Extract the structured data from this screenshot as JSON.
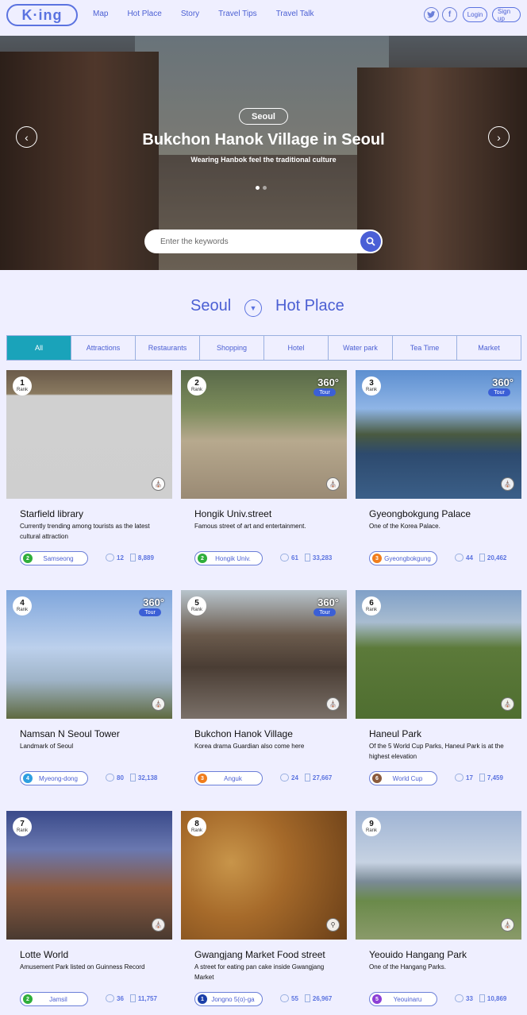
{
  "header": {
    "logo": "K·ing",
    "nav": [
      "Map",
      "Hot Place",
      "Story",
      "Travel Tips",
      "Travel Talk"
    ],
    "login": "Login",
    "signup": "Sign up"
  },
  "hero": {
    "tag": "Seoul",
    "title": "Bukchon Hanok Village in Seoul",
    "subtitle": "Wearing Hanbok feel the traditional culture",
    "search_placeholder": "Enter the keywords"
  },
  "section": {
    "city": "Seoul",
    "title": "Hot Place"
  },
  "tabs": [
    "All",
    "Attractions",
    "Restaurants",
    "Shopping",
    "Hotel",
    "Water park",
    "Tea Time",
    "Market"
  ],
  "rank_label": "Rank",
  "tour_label": "Tour",
  "tour_deg": "360°",
  "cards": [
    {
      "rank": "1",
      "name": "Starfield library",
      "desc": "Currently trending among tourists as the latest cultural attraction",
      "line": "2",
      "line_color": "#2fae3a",
      "station": "Samseong",
      "comments": "12",
      "bookmarks": "8,889"
    },
    {
      "rank": "2",
      "name": "Hongik Univ.street",
      "desc": "Famous street of art and entertainment.",
      "line": "2",
      "line_color": "#2fae3a",
      "station": "Hongik Univ.",
      "comments": "61",
      "bookmarks": "33,283"
    },
    {
      "rank": "3",
      "name": "Gyeongbokgung Palace",
      "desc": "One of the Korea Palace.",
      "line": "3",
      "line_color": "#f07d1c",
      "station": "Gyeongbokgung",
      "comments": "44",
      "bookmarks": "20,462"
    },
    {
      "rank": "4",
      "name": "Namsan N Seoul Tower",
      "desc": "Landmark of Seoul",
      "line": "4",
      "line_color": "#2e9fe0",
      "station": "Myeong-dong",
      "comments": "80",
      "bookmarks": "32,138"
    },
    {
      "rank": "5",
      "name": "Bukchon Hanok Village",
      "desc": "Korea drama Guardian also come here",
      "line": "3",
      "line_color": "#f07d1c",
      "station": "Anguk",
      "comments": "24",
      "bookmarks": "27,667"
    },
    {
      "rank": "6",
      "name": "Haneul Park",
      "desc": "Of the 5 World Cup Parks, Haneul Park is at the highest elevation",
      "line": "6",
      "line_color": "#8a5a3c",
      "station": "World Cup",
      "comments": "17",
      "bookmarks": "7,459"
    },
    {
      "rank": "7",
      "name": "Lotte World",
      "desc": "Amusement Park listed on Guinness Record",
      "line": "2",
      "line_color": "#2fae3a",
      "station": "Jamsil",
      "comments": "36",
      "bookmarks": "11,757"
    },
    {
      "rank": "8",
      "name": "Gwangjang Market Food street",
      "desc": "A street for eating pan cake inside Gwangjang Market",
      "line": "1",
      "line_color": "#1b3fa8",
      "station": "Jongno 5(o)-ga",
      "comments": "55",
      "bookmarks": "26,967"
    },
    {
      "rank": "9",
      "name": "Yeouido Hangang Park",
      "desc": "One of the Hangang Parks.",
      "line": "5",
      "line_color": "#8c3fd6",
      "station": "Yeouinaru",
      "comments": "33",
      "bookmarks": "10,869"
    }
  ]
}
